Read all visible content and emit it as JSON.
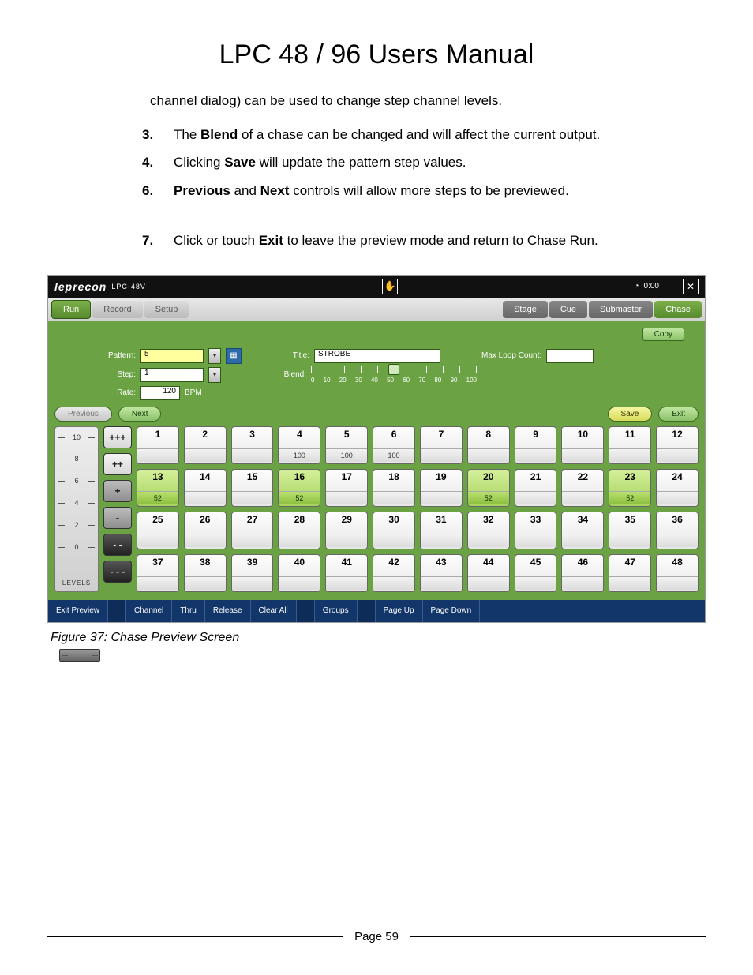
{
  "title": "LPC 48 / 96 Users Manual",
  "intro_fragment": "channel dialog) can be used to change step channel levels.",
  "steps": [
    {
      "n": "3.",
      "html": "The <b>Blend</b> of a chase can be changed and will affect the current output."
    },
    {
      "n": "4.",
      "html": "Clicking <b>Save</b> will update the pattern step values."
    },
    {
      "n": "6.",
      "html": "<b>Previous</b> and <b>Next</b> controls will allow more steps to be previewed."
    },
    {
      "n": "7.",
      "html": " Click or touch <b>Exit</b> to leave the preview mode and return to Chase Run."
    }
  ],
  "figure_caption": "Figure 37: Chase Preview Screen",
  "page_label": "Page 59",
  "screenshot": {
    "logo": "leprecon",
    "logo_sub": "LPC-48V",
    "clock": "0:00",
    "tabs_left": {
      "run": "Run",
      "record": "Record",
      "setup": "Setup"
    },
    "tabs_right": {
      "stage": "Stage",
      "cue": "Cue",
      "submaster": "Submaster",
      "chase": "Chase"
    },
    "copy_btn": "Copy",
    "form": {
      "pattern_label": "Pattern:",
      "pattern_value": "5",
      "step_label": "Step:",
      "step_value": "1",
      "rate_label": "Rate:",
      "rate_value": "120",
      "rate_unit": "BPM",
      "title_label": "Title:",
      "title_value": "STROBE",
      "blend_label": "Blend:",
      "maxloop_label": "Max Loop Count:",
      "maxloop_value": ""
    },
    "blend_ticks": [
      "0",
      "10",
      "20",
      "30",
      "40",
      "50",
      "60",
      "70",
      "80",
      "90",
      "100"
    ],
    "nav": {
      "previous": "Previous",
      "next": "Next",
      "save": "Save",
      "exit": "Exit"
    },
    "inc_buttons": [
      "+++",
      "++",
      "+",
      "-",
      "- -",
      "- - -"
    ],
    "level_scale": [
      "10",
      "8",
      "6",
      "4",
      "2",
      "0"
    ],
    "level_caption": "LEVELS",
    "channels": [
      {
        "n": 1
      },
      {
        "n": 2
      },
      {
        "n": 3
      },
      {
        "n": 4,
        "v": "100"
      },
      {
        "n": 5,
        "v": "100"
      },
      {
        "n": 6,
        "v": "100"
      },
      {
        "n": 7
      },
      {
        "n": 8
      },
      {
        "n": 9
      },
      {
        "n": 10
      },
      {
        "n": 11
      },
      {
        "n": 12
      },
      {
        "n": 13,
        "sel": true,
        "v": "52"
      },
      {
        "n": 14
      },
      {
        "n": 15
      },
      {
        "n": 16,
        "sel": true,
        "v": "52"
      },
      {
        "n": 17
      },
      {
        "n": 18
      },
      {
        "n": 19
      },
      {
        "n": 20,
        "sel": true,
        "v": "52"
      },
      {
        "n": 21
      },
      {
        "n": 22
      },
      {
        "n": 23,
        "sel": true,
        "v": "52"
      },
      {
        "n": 24
      },
      {
        "n": 25
      },
      {
        "n": 26
      },
      {
        "n": 27
      },
      {
        "n": 28
      },
      {
        "n": 29
      },
      {
        "n": 30
      },
      {
        "n": 31
      },
      {
        "n": 32
      },
      {
        "n": 33
      },
      {
        "n": 34
      },
      {
        "n": 35
      },
      {
        "n": 36
      },
      {
        "n": 37
      },
      {
        "n": 38
      },
      {
        "n": 39
      },
      {
        "n": 40
      },
      {
        "n": 41
      },
      {
        "n": 42
      },
      {
        "n": 43
      },
      {
        "n": 44
      },
      {
        "n": 45
      },
      {
        "n": 46
      },
      {
        "n": 47
      },
      {
        "n": 48
      }
    ],
    "bottom": [
      "Exit Preview",
      "",
      "Channel",
      "Thru",
      "Release",
      "Clear All",
      "",
      "Groups",
      "",
      "Page Up",
      "Page Down"
    ]
  }
}
